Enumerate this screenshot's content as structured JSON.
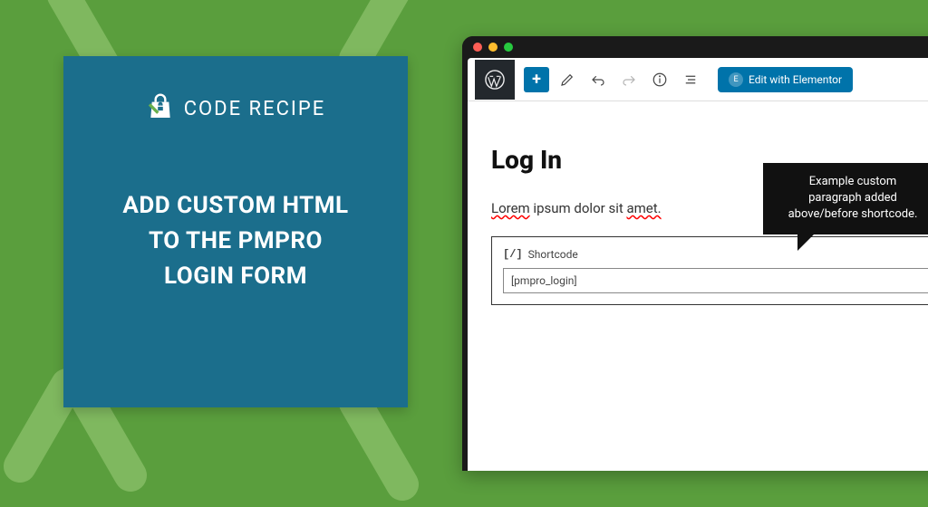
{
  "brand": {
    "label": "CODE RECIPE"
  },
  "headline": {
    "line1": "ADD CUSTOM HTML",
    "line2": "TO THE PMPRO",
    "line3": "LOGIN FORM"
  },
  "toolbar": {
    "add_label": "+",
    "elementor_label": "Edit with Elementor",
    "elementor_badge": "E"
  },
  "editor": {
    "title": "Log In",
    "paragraph_words": [
      "Lorem",
      "ipsum",
      "dolor",
      "sit",
      "amet."
    ],
    "paragraph_spellcheck": [
      true,
      false,
      false,
      false,
      true
    ],
    "block_icon": "[/]",
    "block_label": "Shortcode",
    "shortcode_value": "[pmpro_login]"
  },
  "tooltip": {
    "line1": "Example custom",
    "line2": "paragraph added",
    "line3": "above/before shortcode."
  }
}
